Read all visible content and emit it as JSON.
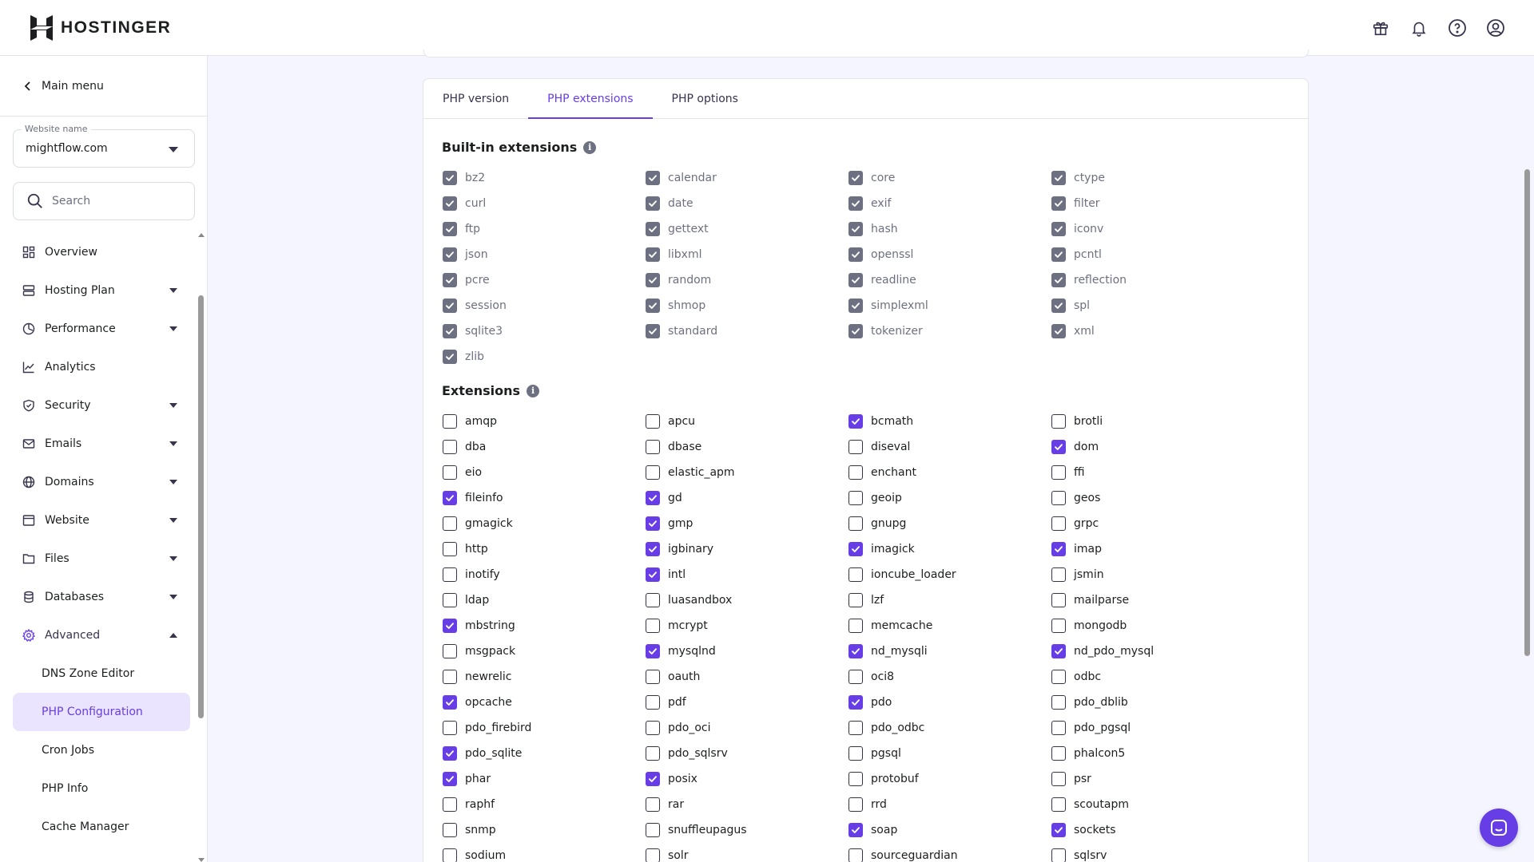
{
  "brand": {
    "name": "HOSTINGER"
  },
  "sidebar": {
    "main_menu": "Main menu",
    "website_label": "Website name",
    "website_value": "mightflow.com",
    "search_placeholder": "Search",
    "items": [
      {
        "label": "Overview",
        "icon": "overview-icon",
        "caret": false
      },
      {
        "label": "Hosting Plan",
        "icon": "server-icon",
        "caret": true
      },
      {
        "label": "Performance",
        "icon": "gauge-icon",
        "caret": true
      },
      {
        "label": "Analytics",
        "icon": "chart-icon",
        "caret": false
      },
      {
        "label": "Security",
        "icon": "shield-icon",
        "caret": true
      },
      {
        "label": "Emails",
        "icon": "mail-icon",
        "caret": true
      },
      {
        "label": "Domains",
        "icon": "globe-icon",
        "caret": true
      },
      {
        "label": "Website",
        "icon": "browser-icon",
        "caret": true
      },
      {
        "label": "Files",
        "icon": "folder-icon",
        "caret": true
      },
      {
        "label": "Databases",
        "icon": "database-icon",
        "caret": true
      },
      {
        "label": "Advanced",
        "icon": "gear-icon",
        "caret": true,
        "expanded": true
      }
    ],
    "sub_items": [
      {
        "label": "DNS Zone Editor",
        "active": false
      },
      {
        "label": "PHP Configuration",
        "active": true
      },
      {
        "label": "Cron Jobs",
        "active": false
      },
      {
        "label": "PHP Info",
        "active": false
      },
      {
        "label": "Cache Manager",
        "active": false
      }
    ]
  },
  "tabs": [
    {
      "label": "PHP version",
      "active": false
    },
    {
      "label": "PHP extensions",
      "active": true
    },
    {
      "label": "PHP options",
      "active": false
    }
  ],
  "builtin": {
    "title": "Built-in extensions",
    "items": [
      "bz2",
      "calendar",
      "core",
      "ctype",
      "curl",
      "date",
      "exif",
      "filter",
      "ftp",
      "gettext",
      "hash",
      "iconv",
      "json",
      "libxml",
      "openssl",
      "pcntl",
      "pcre",
      "random",
      "readline",
      "reflection",
      "session",
      "shmop",
      "simplexml",
      "spl",
      "sqlite3",
      "standard",
      "tokenizer",
      "xml",
      "zlib"
    ]
  },
  "extensions": {
    "title": "Extensions",
    "items": [
      {
        "name": "amqp",
        "checked": false
      },
      {
        "name": "apcu",
        "checked": false
      },
      {
        "name": "bcmath",
        "checked": true
      },
      {
        "name": "brotli",
        "checked": false
      },
      {
        "name": "dba",
        "checked": false
      },
      {
        "name": "dbase",
        "checked": false
      },
      {
        "name": "diseval",
        "checked": false
      },
      {
        "name": "dom",
        "checked": true
      },
      {
        "name": "eio",
        "checked": false
      },
      {
        "name": "elastic_apm",
        "checked": false
      },
      {
        "name": "enchant",
        "checked": false
      },
      {
        "name": "ffi",
        "checked": false
      },
      {
        "name": "fileinfo",
        "checked": true
      },
      {
        "name": "gd",
        "checked": true
      },
      {
        "name": "geoip",
        "checked": false
      },
      {
        "name": "geos",
        "checked": false
      },
      {
        "name": "gmagick",
        "checked": false
      },
      {
        "name": "gmp",
        "checked": true
      },
      {
        "name": "gnupg",
        "checked": false
      },
      {
        "name": "grpc",
        "checked": false
      },
      {
        "name": "http",
        "checked": false
      },
      {
        "name": "igbinary",
        "checked": true
      },
      {
        "name": "imagick",
        "checked": true
      },
      {
        "name": "imap",
        "checked": true
      },
      {
        "name": "inotify",
        "checked": false
      },
      {
        "name": "intl",
        "checked": true
      },
      {
        "name": "ioncube_loader",
        "checked": false
      },
      {
        "name": "jsmin",
        "checked": false
      },
      {
        "name": "ldap",
        "checked": false
      },
      {
        "name": "luasandbox",
        "checked": false
      },
      {
        "name": "lzf",
        "checked": false
      },
      {
        "name": "mailparse",
        "checked": false
      },
      {
        "name": "mbstring",
        "checked": true
      },
      {
        "name": "mcrypt",
        "checked": false
      },
      {
        "name": "memcache",
        "checked": false
      },
      {
        "name": "mongodb",
        "checked": false
      },
      {
        "name": "msgpack",
        "checked": false
      },
      {
        "name": "mysqlnd",
        "checked": true
      },
      {
        "name": "nd_mysqli",
        "checked": true
      },
      {
        "name": "nd_pdo_mysql",
        "checked": true
      },
      {
        "name": "newrelic",
        "checked": false
      },
      {
        "name": "oauth",
        "checked": false
      },
      {
        "name": "oci8",
        "checked": false
      },
      {
        "name": "odbc",
        "checked": false
      },
      {
        "name": "opcache",
        "checked": true
      },
      {
        "name": "pdf",
        "checked": false
      },
      {
        "name": "pdo",
        "checked": true
      },
      {
        "name": "pdo_dblib",
        "checked": false
      },
      {
        "name": "pdo_firebird",
        "checked": false
      },
      {
        "name": "pdo_oci",
        "checked": false
      },
      {
        "name": "pdo_odbc",
        "checked": false
      },
      {
        "name": "pdo_pgsql",
        "checked": false
      },
      {
        "name": "pdo_sqlite",
        "checked": true
      },
      {
        "name": "pdo_sqlsrv",
        "checked": false
      },
      {
        "name": "pgsql",
        "checked": false
      },
      {
        "name": "phalcon5",
        "checked": false
      },
      {
        "name": "phar",
        "checked": true
      },
      {
        "name": "posix",
        "checked": true
      },
      {
        "name": "protobuf",
        "checked": false
      },
      {
        "name": "psr",
        "checked": false
      },
      {
        "name": "raphf",
        "checked": false
      },
      {
        "name": "rar",
        "checked": false
      },
      {
        "name": "rrd",
        "checked": false
      },
      {
        "name": "scoutapm",
        "checked": false
      },
      {
        "name": "snmp",
        "checked": false
      },
      {
        "name": "snuffleupagus",
        "checked": false
      },
      {
        "name": "soap",
        "checked": true
      },
      {
        "name": "sockets",
        "checked": true
      },
      {
        "name": "sodium",
        "checked": false
      },
      {
        "name": "solr",
        "checked": false
      },
      {
        "name": "sourceguardian",
        "checked": false
      },
      {
        "name": "sqlsrv",
        "checked": false
      }
    ]
  },
  "colors": {
    "accent": "#673de6",
    "accent_bg": "#ebe4ff",
    "muted": "#6d7081"
  }
}
